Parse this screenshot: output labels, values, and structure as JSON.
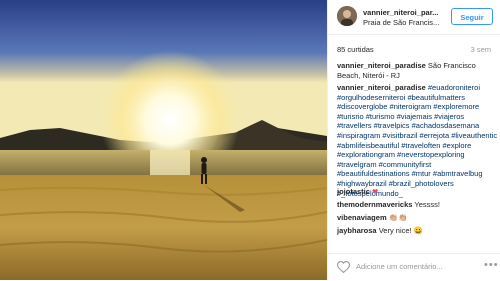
{
  "post": {
    "username": "vannier_niteroi_paradise",
    "username_display": "vannier_niteroi_par...",
    "location": "Praia de São Francis...",
    "follow_label": "Seguir",
    "likes": "85 curtidas",
    "time": "3 sem",
    "caption_user": "vannier_niteroi_paradise",
    "caption_text": "São Francisco Beach, Niterói - RJ",
    "tags_user": "vannier_niteroi_paradise",
    "tags_text": "#euadoroniteroi #orgulhodeserniteroi #beautifulmatters #discoverglobe #niteroigram #exploremore #turisrio #turismo #viajemais #viajeros #travellers #travelpics #achadosdasemana #inspiragram #visitbrazil #errejota #liveauthentic #abmlifeisbeautiful #traveloften #explore #explorationgram #neverstopexploring #travelgram #communityfirst #beautifuldestinations #mtur #abmtravelbug #highwaybrazil #brazil_photolovers #_fotospelomundo_",
    "comments": [
      {
        "user": "jojotastic",
        "text": "❤"
      },
      {
        "user": "themodernmavericks",
        "text": "Yessss!"
      },
      {
        "user": "vibenaviagem",
        "text": "👏🏼👏🏼"
      },
      {
        "user": "jaybharosa",
        "text": "Very nice! 😀"
      }
    ],
    "add_comment_placeholder": "Adicione um comentário...",
    "more_label": "•••"
  },
  "icons": {
    "like": "heart-icon",
    "more": "more-options-icon"
  },
  "colors": {
    "accent": "#3897f0",
    "text": "#262626",
    "muted": "#999999",
    "heart": "#ed4956"
  }
}
